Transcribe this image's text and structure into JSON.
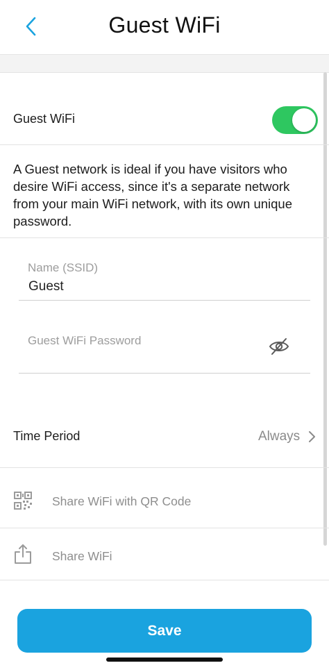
{
  "header": {
    "title": "Guest WiFi",
    "back_icon": "chevron-left-icon"
  },
  "guest_toggle": {
    "label": "Guest WiFi",
    "on": true,
    "color": "#2ec760"
  },
  "description": "A Guest network is ideal if you have visitors who desire WiFi access, since it's a separate network from your main WiFi network, with its own unique password.",
  "ssid": {
    "label": "Name (SSID)",
    "value": "Guest"
  },
  "password": {
    "placeholder": "Guest WiFi Password",
    "icon": "eye-off-icon"
  },
  "time_period": {
    "label": "Time Period",
    "value": "Always"
  },
  "share_qr": {
    "label": "Share WiFi with QR Code",
    "icon": "qr-code-icon"
  },
  "share_wifi": {
    "label": "Share WiFi",
    "icon": "share-icon"
  },
  "save_button": {
    "label": "Save",
    "color": "#1aa3df"
  }
}
